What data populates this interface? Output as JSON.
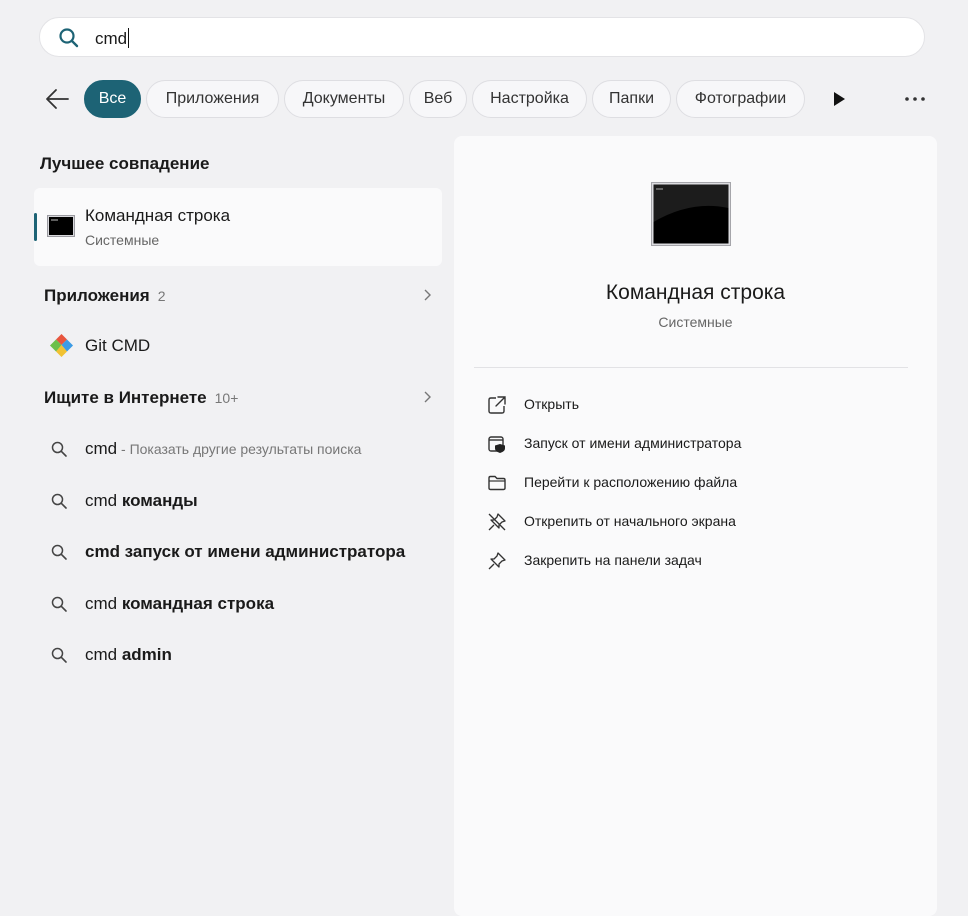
{
  "search": {
    "query": "cmd"
  },
  "filters": [
    "Все",
    "Приложения",
    "Документы",
    "Веб",
    "Настройка",
    "Папки",
    "Фотографии"
  ],
  "best_match": {
    "heading": "Лучшее совпадение",
    "title": "Командная строка",
    "subtitle": "Системные"
  },
  "apps": {
    "heading": "Приложения",
    "count": "2",
    "items": [
      {
        "label": "Git CMD",
        "icon": "git-icon"
      }
    ]
  },
  "web": {
    "heading": "Ищите в Интернете",
    "count": "10+",
    "items": [
      {
        "prefix": "cmd",
        "bold": "",
        "hint": " - Показать другие результаты поиска"
      },
      {
        "prefix": "cmd ",
        "bold": "команды",
        "hint": ""
      },
      {
        "prefix": "",
        "bold": "cmd запуск от имени администратора",
        "hint": ""
      },
      {
        "prefix": "cmd ",
        "bold": "командная строка",
        "hint": ""
      },
      {
        "prefix": "cmd ",
        "bold": "admin",
        "hint": ""
      }
    ]
  },
  "preview": {
    "title": "Командная строка",
    "subtitle": "Системные",
    "actions": [
      {
        "label": "Открыть",
        "icon": "open-icon"
      },
      {
        "label": "Запуск от имени администратора",
        "icon": "shield-icon"
      },
      {
        "label": "Перейти к расположению файла",
        "icon": "folder-icon"
      },
      {
        "label": "Открепить от начального экрана",
        "icon": "unpin-icon"
      },
      {
        "label": "Закрепить на панели задач",
        "icon": "pin-icon"
      }
    ]
  },
  "colors": {
    "accent": "#1d6375",
    "background": "#f1f1f3",
    "panel": "#fafafb"
  }
}
